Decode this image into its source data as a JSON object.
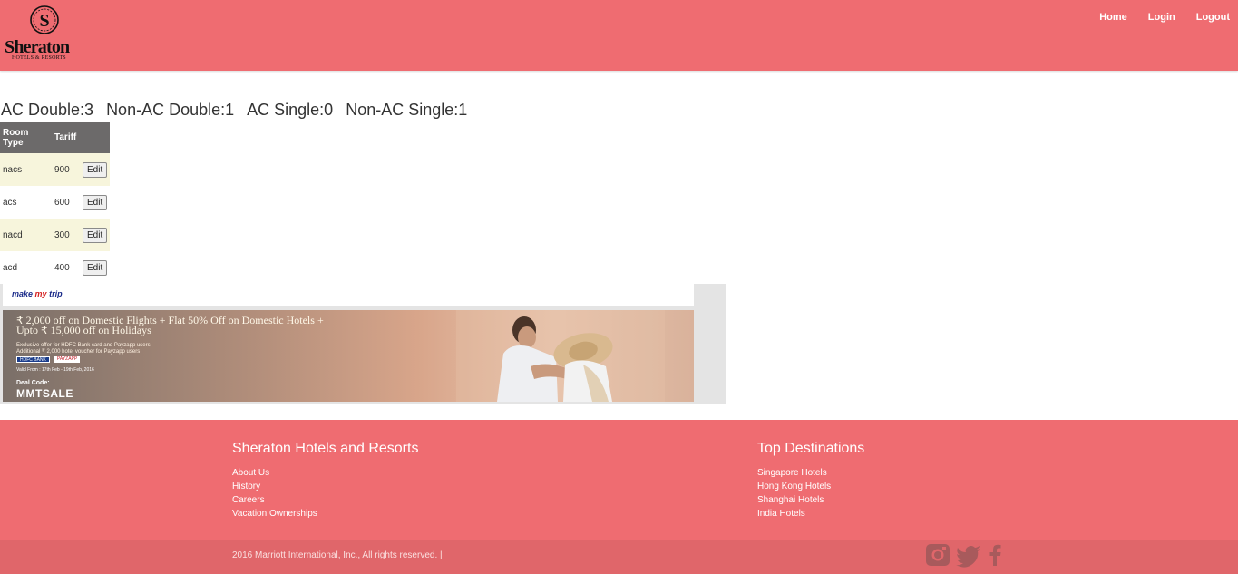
{
  "brand": {
    "logo_text": "Sheraton",
    "logo_sub": "HOTELS & RESORTS",
    "logo_initial": "S"
  },
  "nav": {
    "home": "Home",
    "login": "Login",
    "logout": "Logout"
  },
  "availability": {
    "ac_double": "AC Double:3",
    "nonac_double": "Non-AC Double:1",
    "ac_single": "AC Single:0",
    "nonac_single": "Non-AC Single:1"
  },
  "table": {
    "headers": [
      "Room Type",
      "Tariff"
    ],
    "rows": [
      {
        "type": "nacs",
        "tariff": "900",
        "action": "Edit"
      },
      {
        "type": "acs",
        "tariff": "600",
        "action": "Edit"
      },
      {
        "type": "nacd",
        "tariff": "300",
        "action": "Edit"
      },
      {
        "type": "acd",
        "tariff": "400",
        "action": "Edit"
      }
    ]
  },
  "ad": {
    "brand_make": "make",
    "brand_my": "my",
    "brand_trip": "trip",
    "headline_1": "₹ 2,000 off on Domestic Flights + Flat 50% Off on Domestic Hotels +",
    "headline_2": "Upto ₹ 15,000 off on Holidays",
    "fine_1": "Exclusive offer for HDFC Bank card and Payzapp users",
    "fine_2": "Additional ₹ 2,000 hotel voucher for Payzapp users",
    "logo_bank": "HDFC BANK",
    "logo_pay": "PAYZAPP",
    "valid": "Valid From : 17th Feb - 19th Feb, 2016",
    "deal_label": "Deal Code:",
    "deal_code": "MMTSALE"
  },
  "footer": {
    "col1": {
      "title": "Sheraton Hotels and Resorts",
      "links": [
        "About Us",
        "History",
        "Careers",
        "Vacation Ownerships"
      ]
    },
    "col2": {
      "title": "Top Destinations",
      "links": [
        "Singapore Hotels",
        "Hong Kong Hotels",
        "Shanghai Hotels",
        "India Hotels"
      ]
    },
    "copyright": "2016 Marriott International, Inc., All rights reserved. |",
    "social": [
      "instagram-icon",
      "twitter-icon",
      "facebook-icon"
    ],
    "social_color": "#a85a5c"
  },
  "colors": {
    "header_bg": "#ef6c71",
    "footer_bottom_bg": "#e0666a",
    "table_header_bg": "#6c6a6a",
    "row_alt_bg": "#f7f5dc"
  }
}
